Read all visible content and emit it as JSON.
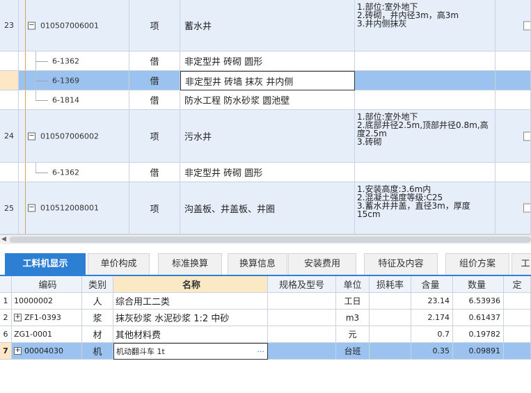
{
  "upper_rows": [
    {
      "index": "23",
      "code": "010507006001",
      "type": "项",
      "name": "蓄水井",
      "features": "1.部位:室外地下\n2.砖砌，井内径3m，高3m\n3.井内侧抹灰",
      "kind": "parent"
    },
    {
      "index": "",
      "code": "6-1362",
      "type": "借",
      "name": "非定型井 砖砌 圆形",
      "features": "",
      "kind": "child"
    },
    {
      "index": "",
      "code": "6-1369",
      "type": "借",
      "name": "非定型井 砖墙 抹灰 井内侧",
      "features": "",
      "kind": "selected"
    },
    {
      "index": "",
      "code": "6-1814",
      "type": "借",
      "name": "防水工程 防水砂浆 圆池壁",
      "features": "",
      "kind": "child"
    },
    {
      "index": "24",
      "code": "010507006002",
      "type": "项",
      "name": "污水井",
      "features": "1.部位:室外地下\n2.底部井径2.5m,顶部井径0.8m,高度2.5m\n3.砖砌",
      "kind": "parent"
    },
    {
      "index": "",
      "code": "6-1362",
      "type": "借",
      "name": "非定型井 砖砌 圆形",
      "features": "",
      "kind": "child"
    },
    {
      "index": "25",
      "code": "010512008001",
      "type": "项",
      "name": "沟盖板、井盖板、井圈",
      "features": "1.安装高度:3.6m内\n2.混凝土强度等级:C25\n3.蓄水井井盖，直径3m，厚度15cm",
      "kind": "parent"
    }
  ],
  "tabs": [
    "工料机显示",
    "单价构成",
    "标准换算",
    "换算信息",
    "安装费用",
    "特征及内容",
    "组价方案",
    "工"
  ],
  "active_tab": "工料机显示",
  "lower_headers": [
    "",
    "编码",
    "类别",
    "名称",
    "规格及型号",
    "单位",
    "损耗率",
    "含量",
    "数量",
    "定"
  ],
  "lower_rows": [
    {
      "row": "1",
      "code": "10000002",
      "expand": false,
      "category": "人",
      "name": "综合用工二类",
      "spec": "",
      "unit": "工日",
      "loss": "",
      "content": "23.14",
      "quantity": "6.53936"
    },
    {
      "row": "2",
      "code": "ZF1-0393",
      "expand": true,
      "category": "浆",
      "name": "抹灰砂浆 水泥砂浆 1:2 中砂",
      "spec": "",
      "unit": "m3",
      "loss": "",
      "content": "2.174",
      "quantity": "0.61437"
    },
    {
      "row": "6",
      "code": "ZG1-0001",
      "expand": false,
      "category": "材",
      "name": "其他材料费",
      "spec": "",
      "unit": "元",
      "loss": "",
      "content": "0.7",
      "quantity": "0.19782"
    },
    {
      "row": "7",
      "code": "00004030",
      "expand": true,
      "category": "机",
      "name": "机动翻斗车 1t",
      "spec": "",
      "unit": "台班",
      "loss": "",
      "content": "0.35",
      "quantity": "0.09891"
    }
  ],
  "ellipsis": "···",
  "colors": {
    "accent": "#2d7fd4",
    "row_blue": "#e6eef9",
    "selected": "#9cc3ef"
  }
}
